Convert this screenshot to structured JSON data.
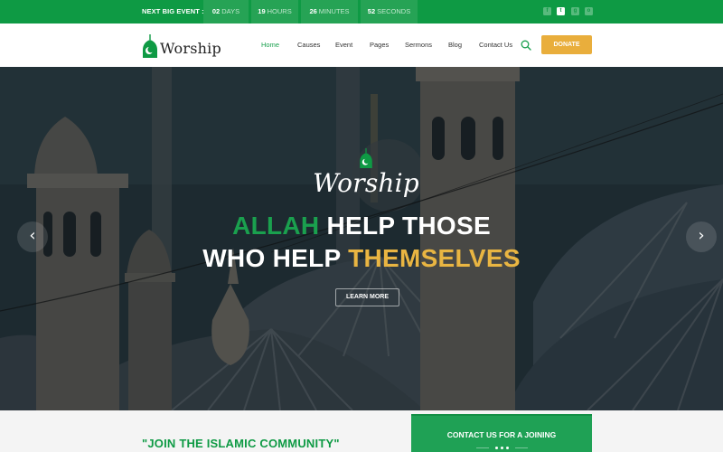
{
  "topbar": {
    "event_label": "NEXT BIG EVENT :",
    "countdown": [
      {
        "value": "02",
        "unit": "DAYS"
      },
      {
        "value": "19",
        "unit": "HOURS"
      },
      {
        "value": "26",
        "unit": "MINUTES"
      },
      {
        "value": "52",
        "unit": "SECONDS"
      }
    ],
    "social": [
      {
        "icon": "facebook-icon",
        "glyph": "f"
      },
      {
        "icon": "twitter-icon",
        "glyph": "t"
      },
      {
        "icon": "google-plus-icon",
        "glyph": "g"
      },
      {
        "icon": "instagram-icon",
        "glyph": "o"
      }
    ]
  },
  "header": {
    "logo_text": "Worship",
    "nav": [
      {
        "label": "Home",
        "active": true
      },
      {
        "label": "Causes"
      },
      {
        "label": "Event"
      },
      {
        "label": "Pages"
      },
      {
        "label": "Sermons"
      },
      {
        "label": "Blog"
      },
      {
        "label": "Contact Us"
      }
    ],
    "search_icon": "search-icon",
    "donate_label": "DONATE"
  },
  "hero": {
    "logo_text": "Worship",
    "headline_line1_highlight": "ALLAH",
    "headline_line1_rest": " HELP THOSE",
    "headline_line2_rest": "WHO HELP ",
    "headline_line2_highlight": "THEMSELVES",
    "cta_label": "LEARN MORE",
    "prev_glyph": "‹",
    "next_glyph": "›"
  },
  "bottom": {
    "join_heading": "\"JOIN THE ISLAMIC COMMUNITY\"",
    "contact_title": "CONTACT US FOR A JOINING"
  },
  "colors": {
    "primary_green": "#0e9a44",
    "accent_gold": "#e9ae3c"
  }
}
